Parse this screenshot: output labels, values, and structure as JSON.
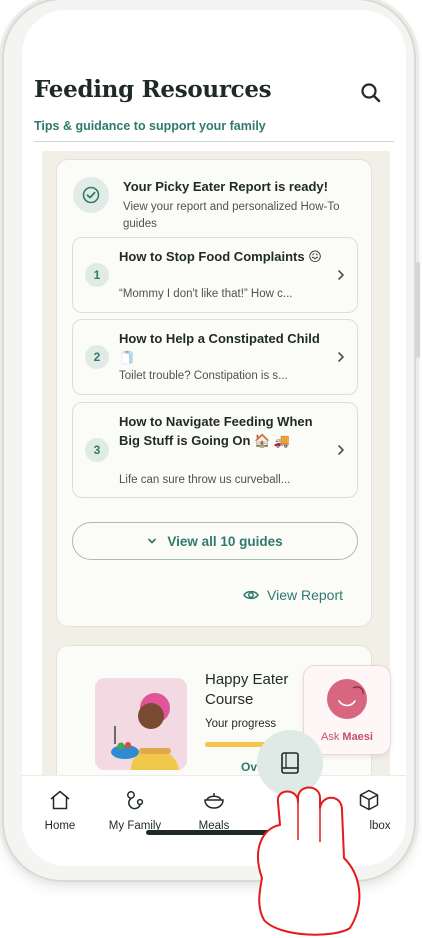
{
  "header": {
    "title": "Feeding Resources",
    "subtitle": "Tips & guidance to support your family"
  },
  "report": {
    "title": "Your Picky Eater Report is ready!",
    "description": "View your report and personalized How-To guides",
    "guides": [
      {
        "number": "1",
        "title": "How to Stop Food Complaints",
        "emoji": "😖",
        "snippet": "“Mommy I don't like that!” How c..."
      },
      {
        "number": "2",
        "title": "How to Help a Constipated Child",
        "emoji": "🧻",
        "snippet": "Toilet trouble? Constipation is s..."
      },
      {
        "number": "3",
        "title": "How to Navigate Feeding When Big Stuff is Going On",
        "emoji": "🏠 🚚",
        "snippet": "Life can sure throw us curveball..."
      }
    ],
    "view_all_label": "View all 10 guides",
    "view_report_label": "View Report"
  },
  "course": {
    "title": "Happy Eater Course",
    "progress_label": "Your progress",
    "progress": 0.55,
    "link_partial": "Ov"
  },
  "ask": {
    "prefix": "Ask",
    "name": "Maesi"
  },
  "tabs": [
    {
      "label": "Home",
      "icon": "home-icon"
    },
    {
      "label": "My Family",
      "icon": "family-icon"
    },
    {
      "label": "Meals",
      "icon": "bowl-icon"
    },
    {
      "label": "Guides",
      "icon": "book-icon"
    },
    {
      "label": "lbox",
      "icon": "box-icon"
    }
  ],
  "colors": {
    "accent": "#2f7a6d",
    "ask_pink": "#d9667f",
    "progress": "#f1c64a"
  }
}
